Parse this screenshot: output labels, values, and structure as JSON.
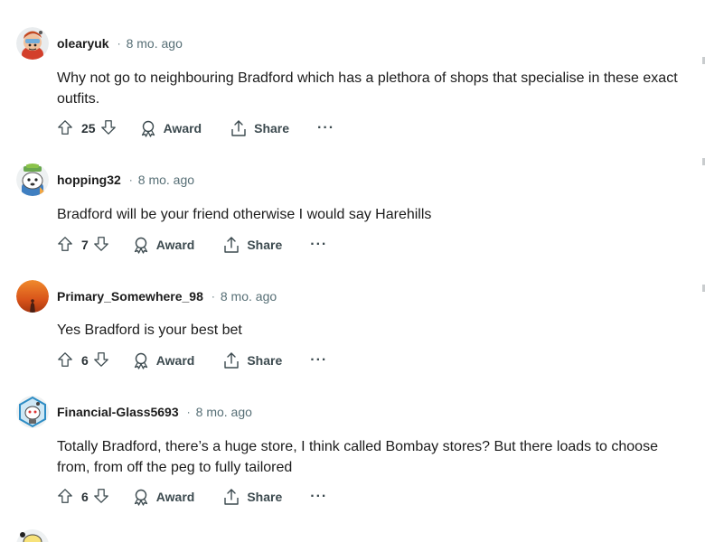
{
  "comments": [
    {
      "username": "olearyuk",
      "separator": "·",
      "time": "8 mo. ago",
      "body": "Why not go to neighbouring Bradford which has a plethora of shops that specialise in these exact outfits.",
      "score": "25",
      "award_label": "Award",
      "share_label": "Share",
      "more_label": "···"
    },
    {
      "username": "hopping32",
      "separator": "·",
      "time": "8 mo. ago",
      "body": "Bradford will be your friend otherwise I would say Harehills",
      "score": "7",
      "award_label": "Award",
      "share_label": "Share",
      "more_label": "···"
    },
    {
      "username": "Primary_Somewhere_98",
      "separator": "·",
      "time": "8 mo. ago",
      "body": "Yes Bradford is your best bet",
      "score": "6",
      "award_label": "Award",
      "share_label": "Share",
      "more_label": "···"
    },
    {
      "username": "Financial-Glass5693",
      "separator": "·",
      "time": "8 mo. ago",
      "body": "Totally Bradford, there’s a huge store, I think called Bombay stores? But there loads to choose from, from off the peg to fully tailored",
      "score": "6",
      "award_label": "Award",
      "share_label": "Share",
      "more_label": "···"
    }
  ],
  "icons": {
    "upvote": "upvote-arrow-icon",
    "downvote": "downvote-arrow-icon",
    "award": "award-ribbon-icon",
    "share": "share-upload-icon",
    "more": "ellipsis-icon"
  },
  "colors": {
    "text": "#1c1c1c",
    "meta": "#576f76",
    "action": "#3c4a4f"
  }
}
